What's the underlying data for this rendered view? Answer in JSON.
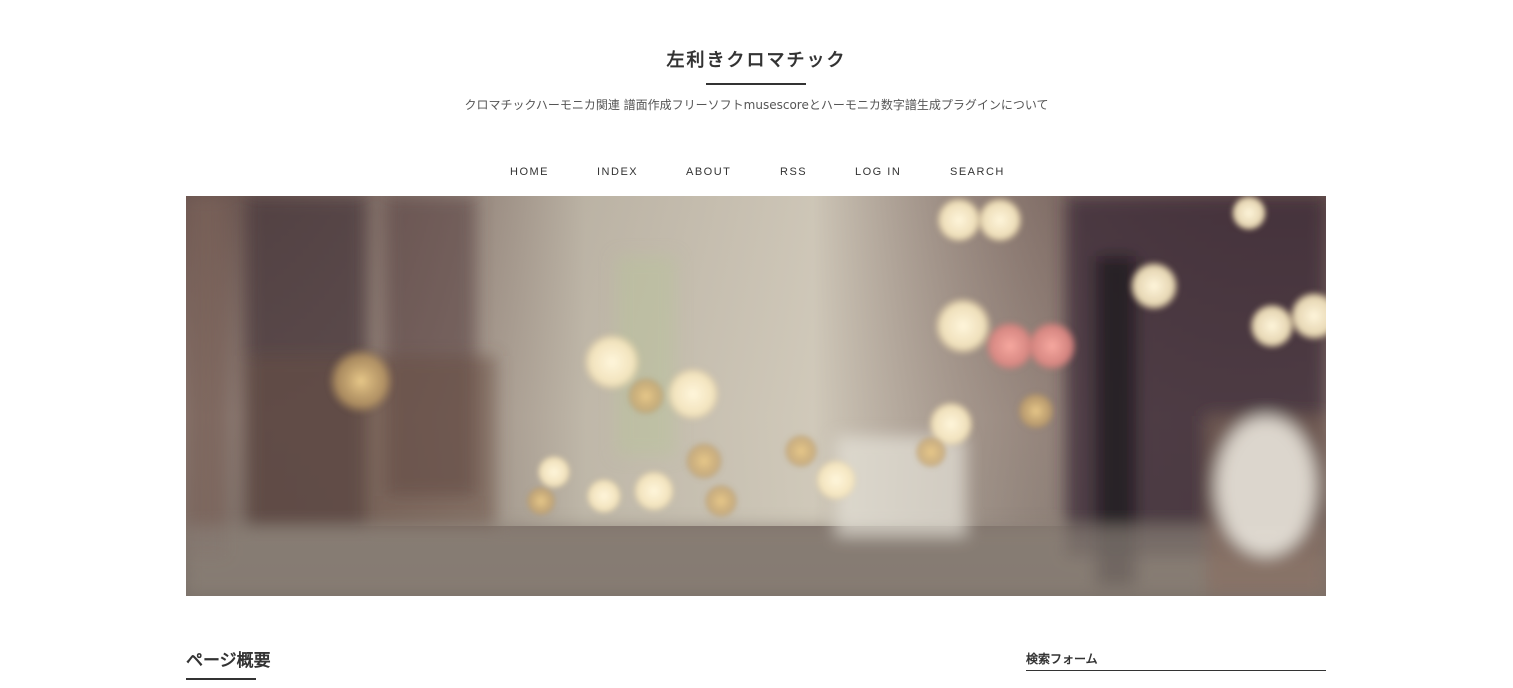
{
  "header": {
    "site_title": "左利きクロマチック",
    "description": "クロマチックハーモニカ関連 譜面作成フリーソフトmusescoreとハーモニカ数字譜生成プラグインについて"
  },
  "nav": {
    "items": [
      {
        "label": "HOME"
      },
      {
        "label": "INDEX"
      },
      {
        "label": "ABOUT"
      },
      {
        "label": "RSS"
      },
      {
        "label": "LOG IN"
      },
      {
        "label": "SEARCH"
      }
    ]
  },
  "main": {
    "section_title": "ページ概要"
  },
  "sidebar": {
    "widget_title": "検索フォーム"
  }
}
